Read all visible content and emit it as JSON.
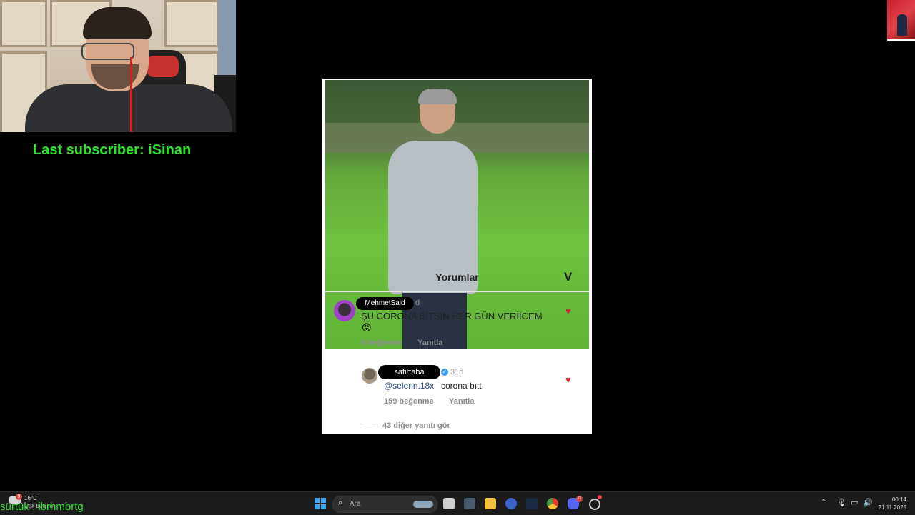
{
  "overlay": {
    "last_subscriber": "Last subscriber: iSinan",
    "chat_line": "sürtük : ibrhmbrtg"
  },
  "post": {
    "comments_title": "Yorumlar",
    "logo_glyph": "V",
    "comments": [
      {
        "username": "MehmetSaid",
        "time": "d",
        "text": "ŞU CORONA BİTSİN HER GÜN VERİİCEM",
        "emoji": "😡",
        "likes": "8 beğenme",
        "reply": "Yanıtla"
      },
      {
        "username": "satirtaha",
        "verified": "✓",
        "time": "31d",
        "mention": "@selenn.18x",
        "text": "corona bıttı",
        "likes": "159 beğenme",
        "reply": "Yanıtla"
      }
    ],
    "more_replies": "43 diğer yanıtı gör"
  },
  "taskbar": {
    "weather_badge": "9",
    "weather_temp": "16°C",
    "weather_desc": "Çok bulutlu",
    "search_placeholder": "Ara",
    "discord_badge": "11",
    "time": "00:14",
    "date": "21.11.2025",
    "icons": [
      "windows-icon",
      "search-icon",
      "task-view-icon",
      "calculator-icon",
      "explorer-icon",
      "edge-icon",
      "steam-icon",
      "chrome-icon",
      "discord-icon",
      "app-icon",
      "chevron-up-icon",
      "mic-icon",
      "network-icon",
      "volume-icon"
    ]
  },
  "colors": {
    "overlay_green": "#2ee32e",
    "heart_red": "#d91e3b",
    "mention_blue": "#2b4a7a",
    "verified_blue": "#3897f0",
    "start_blue": "#3fa9f5"
  }
}
